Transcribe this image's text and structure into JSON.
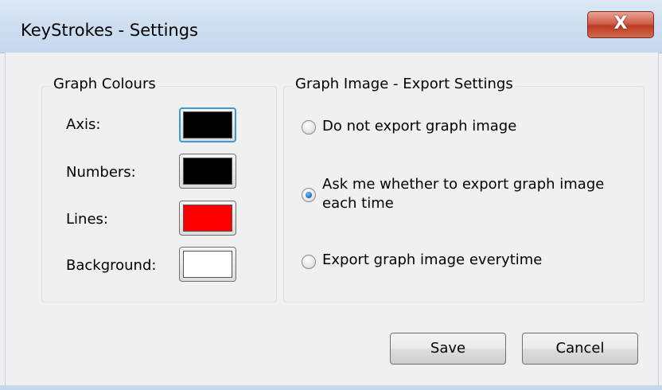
{
  "window": {
    "title": "KeyStrokes - Settings",
    "close_glyph": "X"
  },
  "graph_colours": {
    "heading": "Graph Colours",
    "items": [
      {
        "label": "Axis:",
        "color": "#000000"
      },
      {
        "label": "Numbers:",
        "color": "#000000"
      },
      {
        "label": "Lines:",
        "color": "#ff0000"
      },
      {
        "label": "Background:",
        "color": "#ffffff"
      }
    ]
  },
  "export_settings": {
    "heading": "Graph Image - Export Settings",
    "options": [
      {
        "label": "Do not export graph image",
        "selected": false
      },
      {
        "label": "Ask me whether to export graph image\neach time",
        "selected": true
      },
      {
        "label": "Export graph image everytime",
        "selected": false
      }
    ]
  },
  "buttons": {
    "save": "Save",
    "cancel": "Cancel"
  }
}
